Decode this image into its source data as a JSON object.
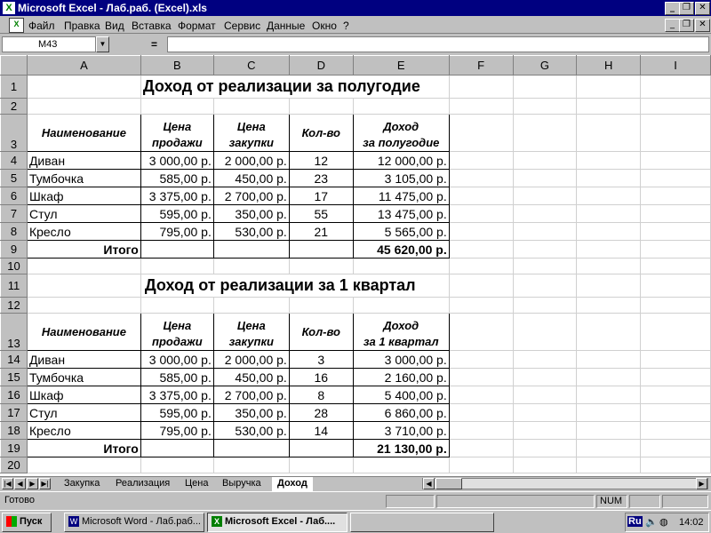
{
  "window": {
    "title": "Microsoft Excel - Лаб.раб. (Excel).xls",
    "app_icon": "excel-icon"
  },
  "menu": [
    "Файл",
    "Правка",
    "Вид",
    "Вставка",
    "Формат",
    "Сервис",
    "Данные",
    "Окно",
    "?"
  ],
  "formula_bar": {
    "cell_ref": "M43",
    "equals": "=",
    "value": ""
  },
  "columns": [
    "A",
    "B",
    "C",
    "D",
    "E",
    "F",
    "G",
    "H",
    "I"
  ],
  "titles": {
    "t1": "Доход от реализации за полугодие",
    "t2": "Доход от реализации за 1 квартал"
  },
  "table1": {
    "headers": {
      "name": "Наименование",
      "sale_1": "Цена",
      "sale_2": "продажи",
      "buy_1": "Цена",
      "buy_2": "закупки",
      "qty": "Кол-во",
      "inc_1": "Доход",
      "inc_2": "за полугодие"
    },
    "rows": [
      [
        "Диван",
        "3 000,00 р.",
        "2 000,00 р.",
        "12",
        "12 000,00 р."
      ],
      [
        "Тумбочка",
        "585,00 р.",
        "450,00 р.",
        "23",
        "3 105,00 р."
      ],
      [
        "Шкаф",
        "3 375,00 р.",
        "2 700,00 р.",
        "17",
        "11 475,00 р."
      ],
      [
        "Стул",
        "595,00 р.",
        "350,00 р.",
        "55",
        "13 475,00 р."
      ],
      [
        "Кресло",
        "795,00 р.",
        "530,00 р.",
        "21",
        "5 565,00 р."
      ]
    ],
    "total_label": "Итого",
    "total_value": "45 620,00 р."
  },
  "table2": {
    "headers": {
      "name": "Наименование",
      "sale_1": "Цена",
      "sale_2": "продажи",
      "buy_1": "Цена",
      "buy_2": "закупки",
      "qty": "Кол-во",
      "inc_1": "Доход",
      "inc_2": "за 1 квартал"
    },
    "rows": [
      [
        "Диван",
        "3 000,00 р.",
        "2 000,00 р.",
        "3",
        "3 000,00 р."
      ],
      [
        "Тумбочка",
        "585,00 р.",
        "450,00 р.",
        "16",
        "2 160,00 р."
      ],
      [
        "Шкаф",
        "3 375,00 р.",
        "2 700,00 р.",
        "8",
        "5 400,00 р."
      ],
      [
        "Стул",
        "595,00 р.",
        "350,00 р.",
        "28",
        "6 860,00 р."
      ],
      [
        "Кресло",
        "795,00 р.",
        "530,00 р.",
        "14",
        "3 710,00 р."
      ]
    ],
    "total_label": "Итого",
    "total_value": "21 130,00 р."
  },
  "sheet_tabs": [
    "Закупка",
    "Реализация",
    "Цена",
    "Выручка",
    "Доход"
  ],
  "active_tab": "Доход",
  "status": {
    "ready": "Готово",
    "num": "NUM"
  },
  "taskbar": {
    "start": "Пуск",
    "word": "Microsoft Word - Лаб.раб...",
    "excel": "Microsoft Excel - Лаб....",
    "lang": "Ru",
    "time": "14:02"
  }
}
